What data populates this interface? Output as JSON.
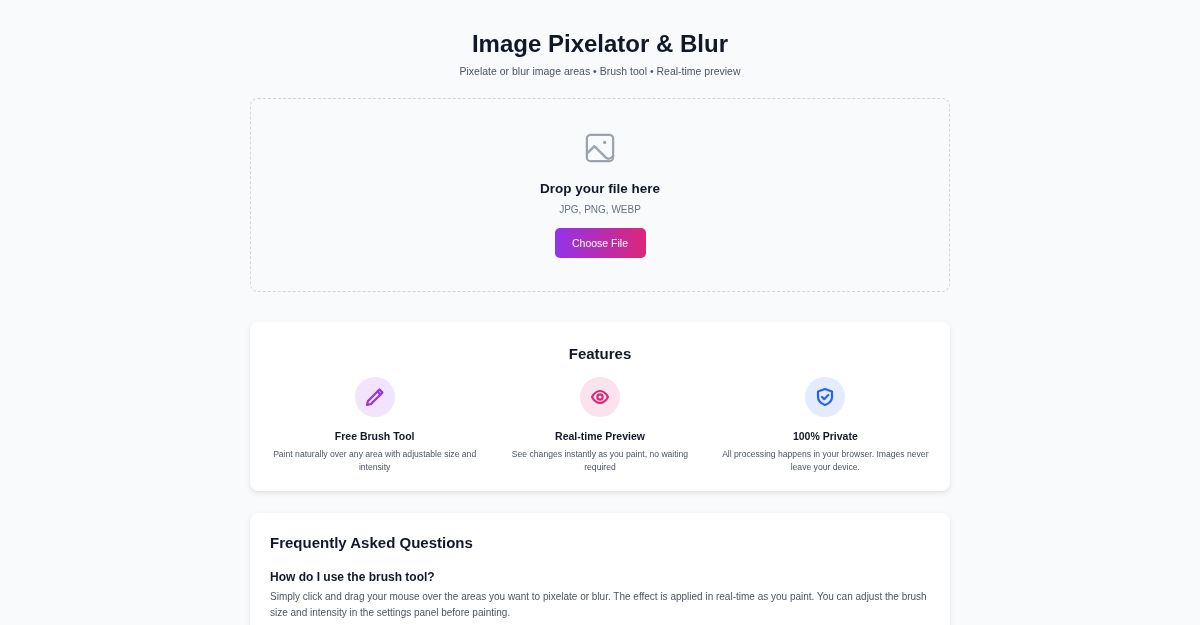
{
  "header": {
    "title": "Image Pixelator & Blur",
    "subtitle": "Pixelate or blur image areas • Brush tool • Real-time preview"
  },
  "dropzone": {
    "heading": "Drop your file here",
    "formats": "JPG, PNG, WEBP",
    "button": "Choose File"
  },
  "features": {
    "title": "Features",
    "items": [
      {
        "kind": "brush",
        "color": "#9333ea",
        "title": "Free Brush Tool",
        "description": "Paint naturally over any area with adjustable size and intensity"
      },
      {
        "kind": "eye",
        "color": "#db2777",
        "title": "Real-time Preview",
        "description": "See changes instantly as you paint, no waiting required"
      },
      {
        "kind": "shield",
        "color": "#2563eb",
        "title": "100% Private",
        "description": "All processing happens in your browser. Images never leave your device."
      }
    ]
  },
  "faq": {
    "title": "Frequently Asked Questions",
    "items": [
      {
        "question": "How do I use the brush tool?",
        "answer": "Simply click and drag your mouse over the areas you want to pixelate or blur. The effect is applied in real-time as you paint. You can adjust the brush size and intensity in the settings panel before painting."
      }
    ]
  }
}
